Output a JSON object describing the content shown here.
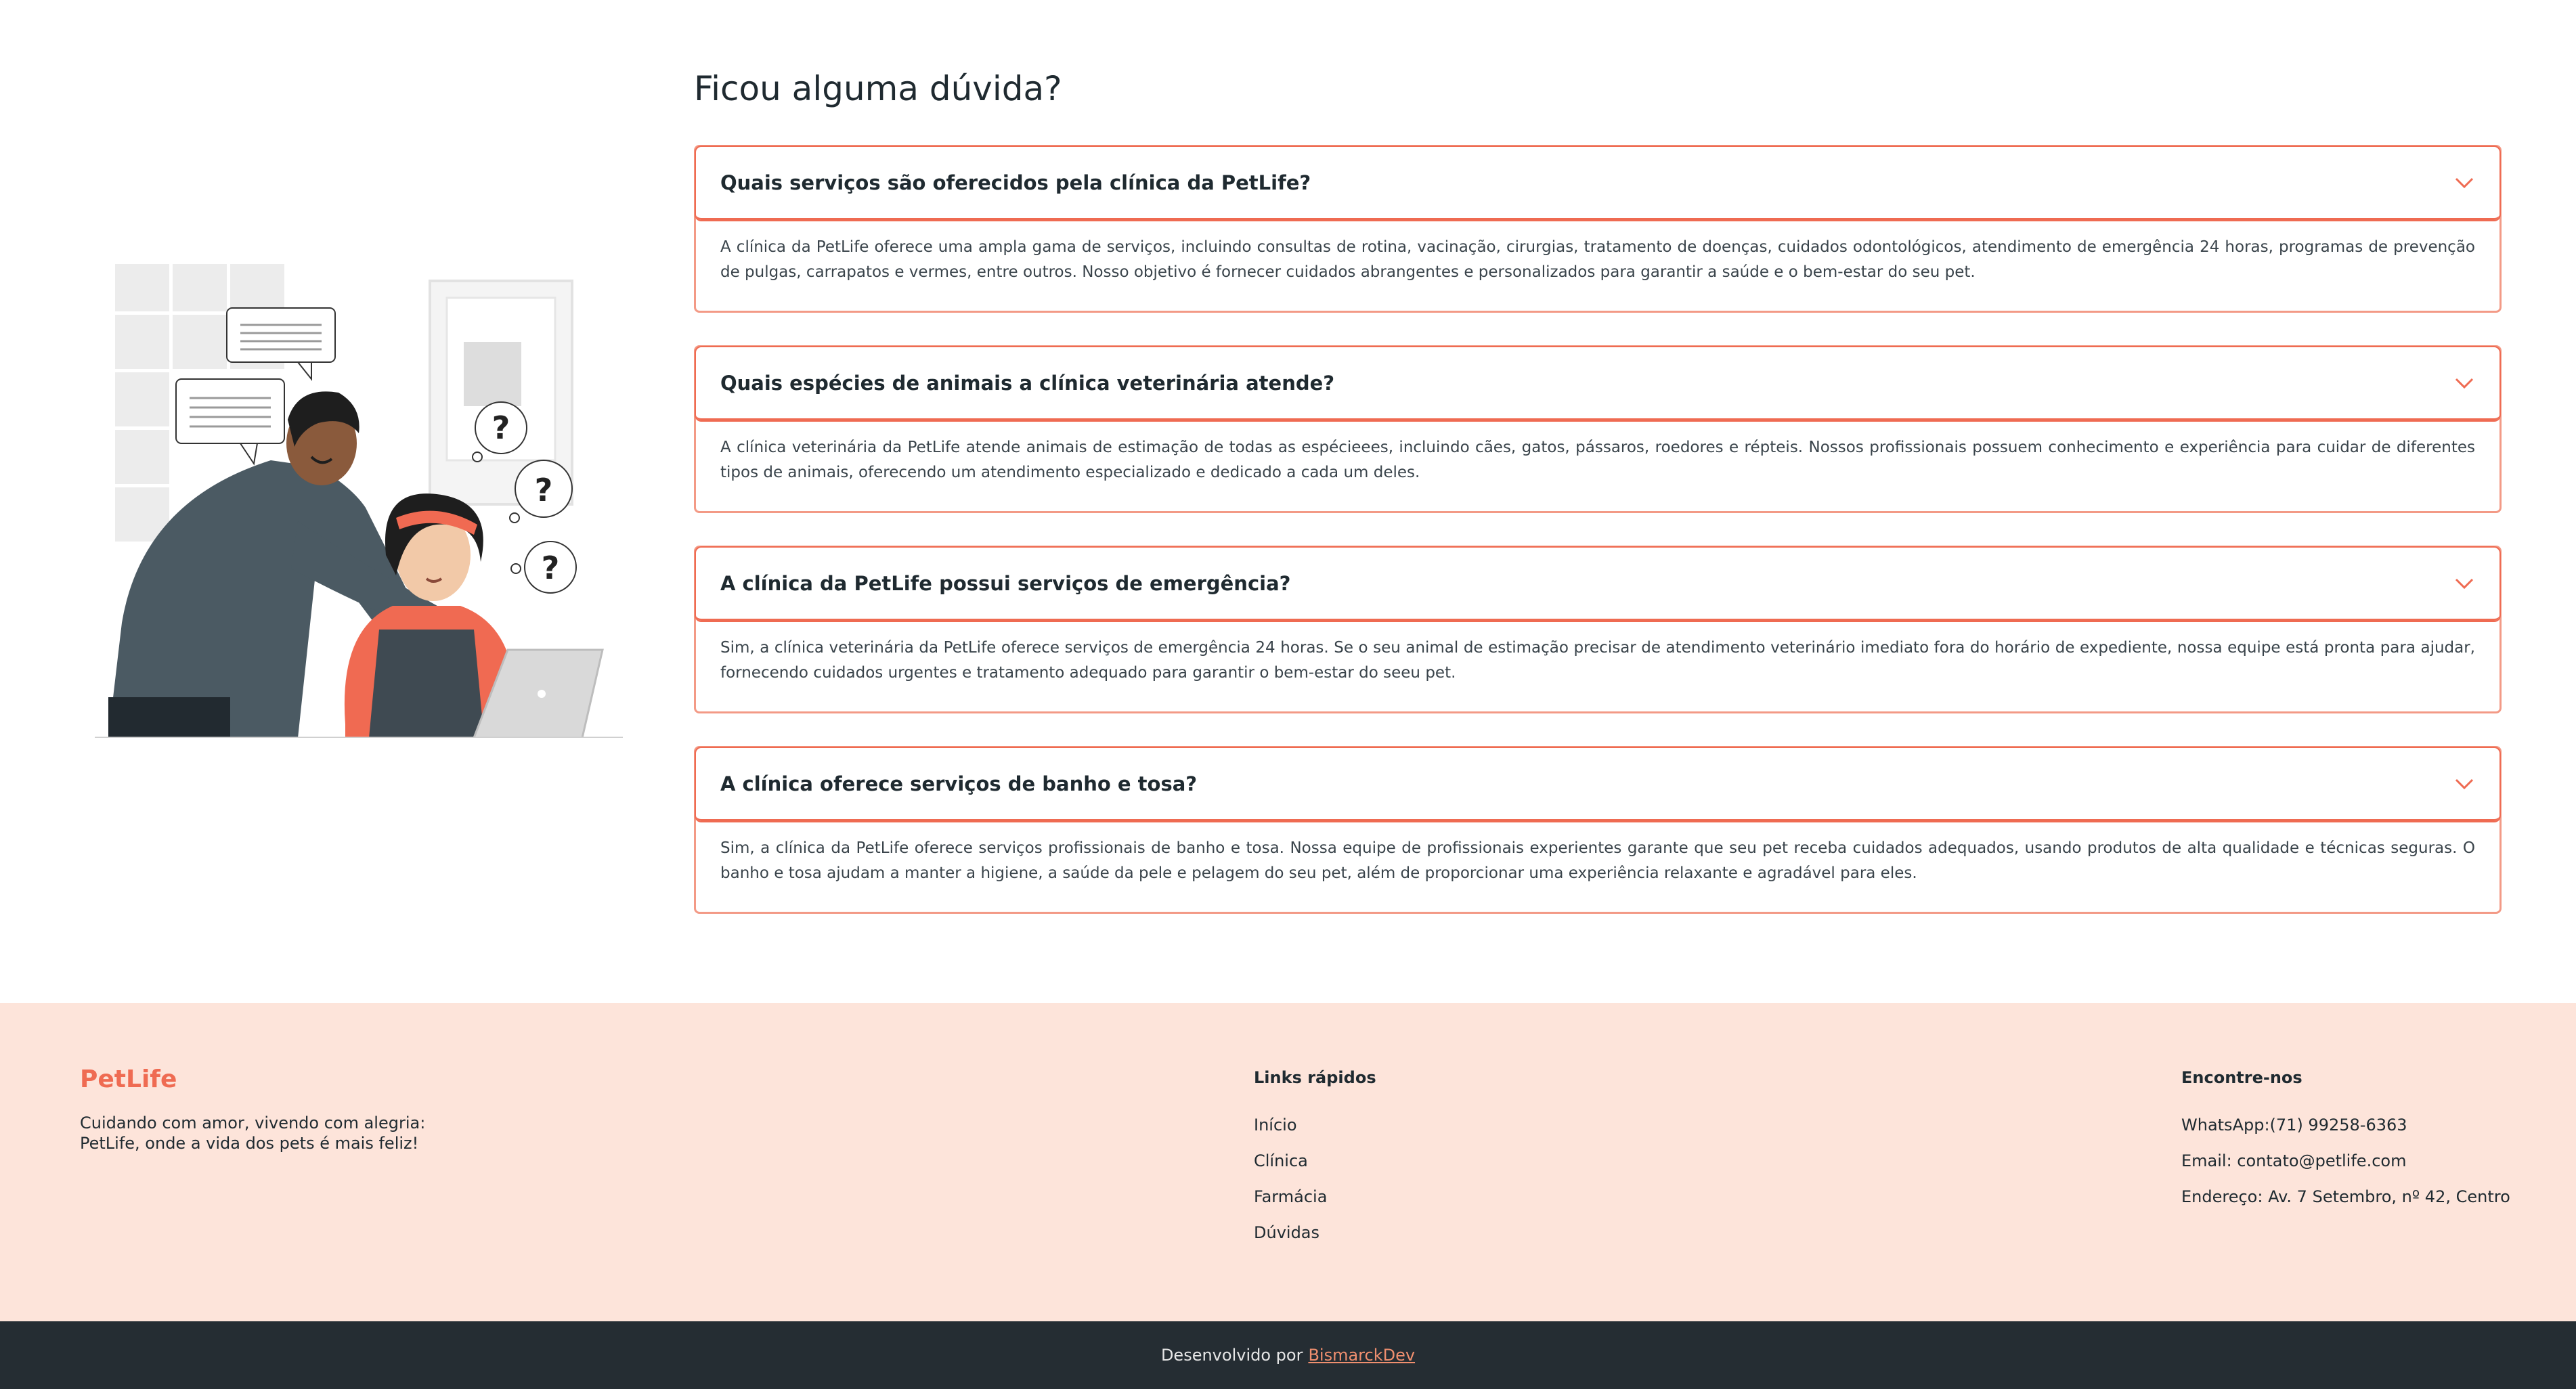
{
  "faq": {
    "title": "Ficou alguma dúvida?",
    "items": [
      {
        "question": "Quais serviços são oferecidos pela clínica da PetLife?",
        "answer": "A clínica da PetLife oferece uma ampla gama de serviços, incluindo consultas de rotina, vacinação, cirurgias, tratamento de doenças, cuidados odontológicos, atendimento de emergência 24 horas, programas de prevenção de pulgas, carrapatos e vermes, entre outros. Nosso objetivo é fornecer cuidados abrangentes e personalizados para garantir a saúde e o bem-estar do seu pet."
      },
      {
        "question": "Quais espécies de animais a clínica veterinária atende?",
        "answer": "A clínica veterinária da PetLife atende animais de estimação de todas as espécieees, incluindo cães, gatos, pássaros, roedores e répteis. Nossos profissionais possuem conhecimento e experiência para cuidar de diferentes tipos de animais, oferecendo um atendimento especializado e dedicado a cada um deles."
      },
      {
        "question": "A clínica da PetLife possui serviços de emergência?",
        "answer": "Sim, a clínica veterinária da PetLife oferece serviços de emergência 24 horas. Se o seu animal de estimação precisar de atendimento veterinário imediato fora do horário de expediente, nossa equipe está pronta para ajudar, fornecendo cuidados urgentes e tratamento adequado para garantir o bem-estar do seeu pet."
      },
      {
        "question": "A clínica oferece serviços de banho e tosa?",
        "answer": "Sim, a clínica da PetLife oferece serviços profissionais de banho e tosa. Nossa equipe de profissionais experientes garante que seu pet receba cuidados adequados, usando produtos de alta qualidade e técnicas seguras. O banho e tosa ajudam a manter a higiene, a saúde da pele e pelagem do seu pet, além de proporcionar uma experiência relaxante e agradável para eles."
      }
    ]
  },
  "footer": {
    "brand": "PetLife",
    "tagline_line1": "Cuidando com amor, vivendo com alegria:",
    "tagline_line2": "PetLife, onde a vida dos pets é mais feliz!",
    "links_title": "Links rápidos",
    "links": [
      "Início",
      "Clínica",
      "Farmácia",
      "Dúvidas"
    ],
    "contact_title": "Encontre-nos",
    "contact": [
      "WhatsApp:(71) 99258-6363",
      "Email: contato@petlife.com",
      "Endereço: Av. 7 Setembro, nº 42, Centro"
    ],
    "credit_prefix": "Desenvolvido por",
    "credit_link": "BismarckDev"
  },
  "colors": {
    "accent": "#ef6b52",
    "footer_bg": "#fde4da",
    "bottom_bar_bg": "#252d33"
  },
  "icons": {
    "faq_toggle": "chevron-down-icon"
  }
}
